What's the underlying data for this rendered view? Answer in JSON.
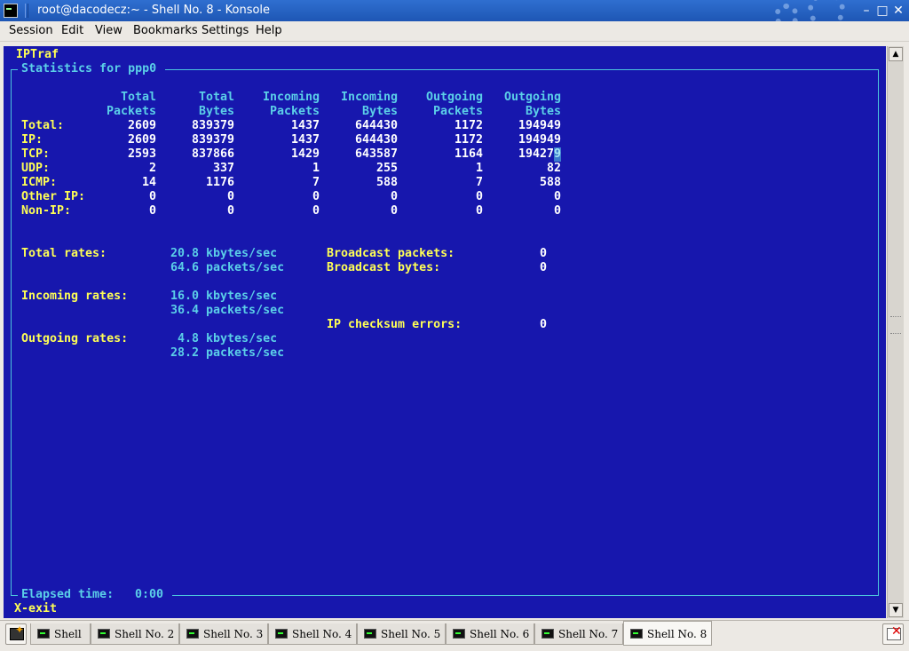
{
  "window": {
    "title": "root@dacodecz:~ - Shell No. 8 - Konsole",
    "icon": "terminal-icon",
    "controls": [
      {
        "name": "minimize",
        "glyph": "–"
      },
      {
        "name": "maximize",
        "glyph": "□"
      },
      {
        "name": "close",
        "glyph": "✕"
      }
    ]
  },
  "menu": [
    "Session",
    "Edit",
    "View",
    "Bookmarks",
    "Settings",
    "Help"
  ],
  "terminal": {
    "app_name": "IPTraf",
    "panel_title": "Statistics for ppp0",
    "column_headers": [
      [
        "Total",
        "Packets"
      ],
      [
        "Total",
        "Bytes"
      ],
      [
        "Incoming",
        "Packets"
      ],
      [
        "Incoming",
        "Bytes"
      ],
      [
        "Outgoing",
        "Packets"
      ],
      [
        "Outgoing",
        "Bytes"
      ]
    ],
    "rows": [
      {
        "label": "Total:",
        "values": [
          "2609",
          "839379",
          "1437",
          "644430",
          "1172",
          "194949"
        ]
      },
      {
        "label": "IP:",
        "values": [
          "2609",
          "839379",
          "1437",
          "644430",
          "1172",
          "194949"
        ]
      },
      {
        "label": "TCP:",
        "values": [
          "2593",
          "837866",
          "1429",
          "643587",
          "1164",
          "194279"
        ]
      },
      {
        "label": "UDP:",
        "values": [
          "2",
          "337",
          "1",
          "255",
          "1",
          "82"
        ]
      },
      {
        "label": "ICMP:",
        "values": [
          "14",
          "1176",
          "7",
          "588",
          "7",
          "588"
        ]
      },
      {
        "label": "Other IP:",
        "values": [
          "0",
          "0",
          "0",
          "0",
          "0",
          "0"
        ]
      },
      {
        "label": "Non-IP:",
        "values": [
          "0",
          "0",
          "0",
          "0",
          "0",
          "0"
        ]
      }
    ],
    "rates": {
      "total_label": "Total rates:",
      "total_kbytes": "20.8 kbytes/sec",
      "total_packets": "64.6 packets/sec",
      "incoming_label": "Incoming rates:",
      "incoming_kbytes": "16.0 kbytes/sec",
      "incoming_packets": "36.4 packets/sec",
      "outgoing_label": "Outgoing rates:",
      "outgoing_kbytes": " 4.8 kbytes/sec",
      "outgoing_packets": "28.2 packets/sec"
    },
    "side_stats": {
      "broadcast_packets_label": "Broadcast packets:",
      "broadcast_packets_value": "0",
      "broadcast_bytes_label": "Broadcast bytes:",
      "broadcast_bytes_value": "0",
      "checksum_label": "IP checksum errors:",
      "checksum_value": "0"
    },
    "elapsed_label": "Elapsed time:",
    "elapsed_value": "0:00",
    "exit_hint": "X-exit"
  },
  "tabs": [
    "Shell",
    "Shell No. 2",
    "Shell No. 3",
    "Shell No. 4",
    "Shell No. 5",
    "Shell No. 6",
    "Shell No. 7",
    "Shell No. 8"
  ],
  "active_tab": 7,
  "colors": {
    "terminal_bg": "#1717ad",
    "label_yellow": "#ffff55",
    "value_cyan": "#5bcfe8",
    "titlebar": "#2a66c8"
  }
}
